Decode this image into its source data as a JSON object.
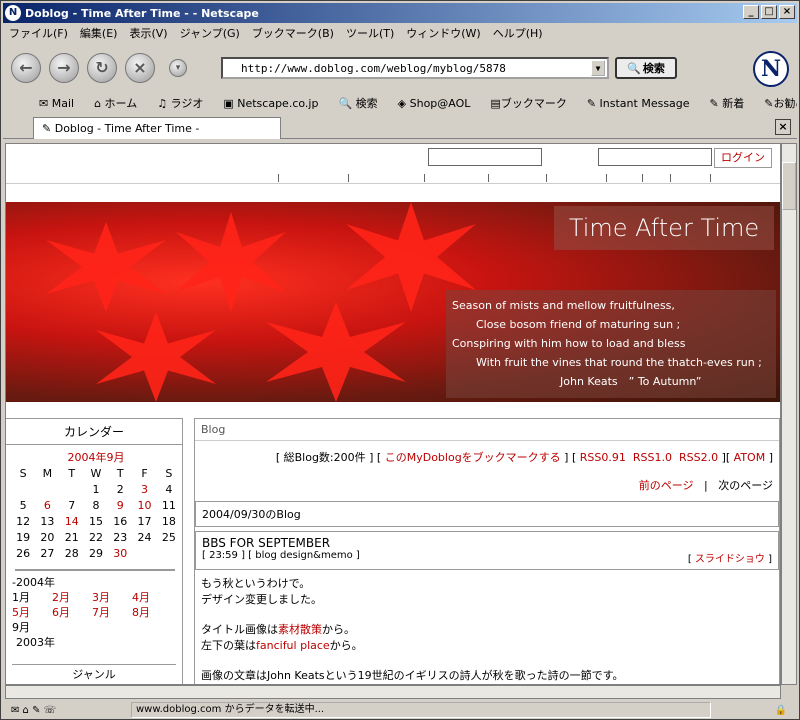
{
  "window": {
    "title": "Doblog - Time After Time - - Netscape"
  },
  "menu": [
    "ファイル(F)",
    "編集(E)",
    "表示(V)",
    "ジャンプ(G)",
    "ブックマーク(B)",
    "ツール(T)",
    "ウィンドウ(W)",
    "ヘルプ(H)"
  ],
  "nav": {
    "url": "http://www.doblog.com/weblog/myblog/5878",
    "search_label": "検索"
  },
  "bookmarks": [
    "Mail",
    "ホーム",
    "ラジオ",
    "Netscape.co.jp",
    "検索",
    "Shop@AOL",
    "ブックマーク",
    "Instant Message",
    "新着",
    "お勧め"
  ],
  "tab": {
    "label": "Doblog - Time After Time -"
  },
  "page": {
    "login_label": "ログイン",
    "banner": {
      "title": "Time After Time",
      "poem": [
        "Season of mists and mellow fruitfulness,",
        "Close bosom friend of maturing sun ;",
        "Conspiring with him how to load and bless",
        "With fruit the vines that round the thatch-eves run ;",
        "John Keats　” To Autumn”"
      ]
    },
    "calendar": {
      "title": "カレンダー",
      "month": "2004年9月",
      "days": [
        "S",
        "M",
        "T",
        "W",
        "T",
        "F",
        "S"
      ],
      "rows": [
        [
          "",
          "",
          "",
          "1",
          "2",
          "3",
          "4"
        ],
        [
          "5",
          "6",
          "7",
          "8",
          "9",
          "10",
          "11"
        ],
        [
          "12",
          "13",
          "14",
          "15",
          "16",
          "17",
          "18"
        ],
        [
          "19",
          "20",
          "21",
          "22",
          "23",
          "24",
          "25"
        ],
        [
          "26",
          "27",
          "28",
          "29",
          "30",
          "",
          ""
        ]
      ],
      "red_days": [
        "3",
        "6",
        "9",
        "10",
        "14",
        "30"
      ]
    },
    "archive": {
      "year": "-2004年",
      "months": [
        [
          "1月",
          "2月",
          "3月",
          "4月"
        ],
        [
          "5月",
          "6月",
          "7月",
          "8月"
        ],
        [
          "9月"
        ]
      ],
      "prev_year": "2003年",
      "genre": "ジャンル"
    },
    "main": {
      "header": "Blog",
      "count": "[ 総Blog数:200件 ]",
      "bookmark_link": "このMyDoblogをブックマークする",
      "rss": [
        "RSS0.91",
        "RSS1.0",
        "RSS2.0",
        "ATOM"
      ],
      "prev": "前のページ",
      "sep": "|",
      "next": "次のページ",
      "date_box": "2004/09/30のBlog",
      "post_title": "BBS FOR SEPTEMBER",
      "post_info": "[ 23:59 ] [ blog design&memo ]",
      "slideshow": "スライドショウ",
      "line1": "もう秋というわけで。",
      "line2": "デザイン変更しました。",
      "line3a": "タイトル画像は",
      "line3b": "素材散策",
      "line3c": "から。",
      "line4a": "左下の葉は",
      "line4b": "fanciful place",
      "line4c": "から。",
      "line5": "画像の文章はJohn Keatsという19世紀のイギリスの詩人が秋を歌った詩の一節です。"
    }
  },
  "status": {
    "message": "www.doblog.com からデータを転送中..."
  }
}
